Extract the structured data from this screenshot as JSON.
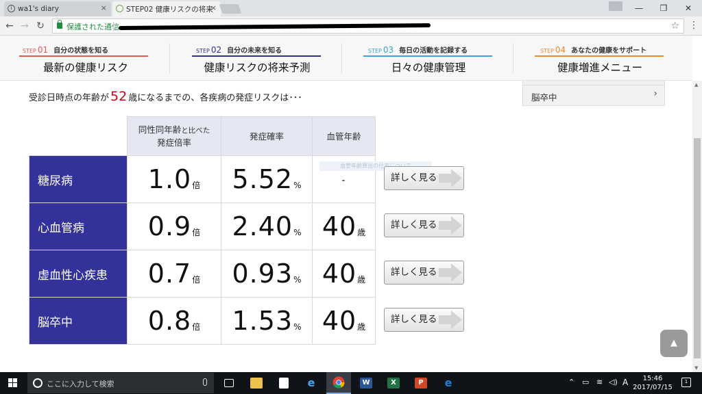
{
  "browser": {
    "tabs": [
      {
        "label": "wa1's diary",
        "close": "×"
      },
      {
        "label": "STEP02 健康リスクの将来",
        "close": "×"
      }
    ],
    "secure_label": "保護された通信",
    "window_controls": {
      "minimize": "—",
      "restore": "❐",
      "close": "✕"
    }
  },
  "site_nav": {
    "steps": [
      {
        "tag": "STEP",
        "num": "01",
        "heading": "自分の状態を知る",
        "title": "最新の健康リスク",
        "color": "#e8584f"
      },
      {
        "tag": "STEP",
        "num": "02",
        "heading": "自分の未来を知る",
        "title": "健康リスクの将来予測",
        "color": "#2e3090"
      },
      {
        "tag": "STEP",
        "num": "03",
        "heading": "毎日の活動を記録する",
        "title": "日々の健康管理",
        "color": "#34a6d8"
      },
      {
        "tag": "STEP",
        "num": "04",
        "heading": "あなたの健康をサポート",
        "title": "健康増進メニュー",
        "color": "#f08a24"
      }
    ]
  },
  "content": {
    "lead_prefix": "受診日時点の年齢が",
    "lead_age": "52",
    "lead_suffix": "歳になるまでの、各疾病の発症リスクは･･･",
    "side_panel_label": "脳卒中",
    "faded_note": "血管年齢算出の仕方について",
    "columns": {
      "ratio_line1": "同性同年齢",
      "ratio_line1_small": "と比べた",
      "ratio_line2": "発症倍率",
      "probability": "発症確率",
      "vascular_age": "血管年齢"
    },
    "rows": [
      {
        "disease": "糖尿病",
        "ratio": "1.0",
        "ratio_unit": "倍",
        "probability": "5.52",
        "probability_unit": "%",
        "vascular_age": "-",
        "vascular_unit": "",
        "button": "詳しく見る"
      },
      {
        "disease": "心血管病",
        "ratio": "0.9",
        "ratio_unit": "倍",
        "probability": "2.40",
        "probability_unit": "%",
        "vascular_age": "40",
        "vascular_unit": "歳",
        "button": "詳しく見る"
      },
      {
        "disease": "虚血性心疾患",
        "ratio": "0.7",
        "ratio_unit": "倍",
        "probability": "0.93",
        "probability_unit": "%",
        "vascular_age": "40",
        "vascular_unit": "歳",
        "button": "詳しく見る"
      },
      {
        "disease": "脳卒中",
        "ratio": "0.8",
        "ratio_unit": "倍",
        "probability": "1.53",
        "probability_unit": "%",
        "vascular_age": "40",
        "vascular_unit": "歳",
        "button": "詳しく見る"
      }
    ],
    "back_to_top": "▲"
  },
  "taskbar": {
    "search_placeholder": "ここに入力して検索",
    "ime": "A",
    "time": "15:46",
    "date": "2017/07/15",
    "notification_count": "1",
    "colors": {
      "word": "#2b579a",
      "excel": "#217346",
      "powerpoint": "#d24726",
      "edge": "#1e7fd8"
    }
  }
}
